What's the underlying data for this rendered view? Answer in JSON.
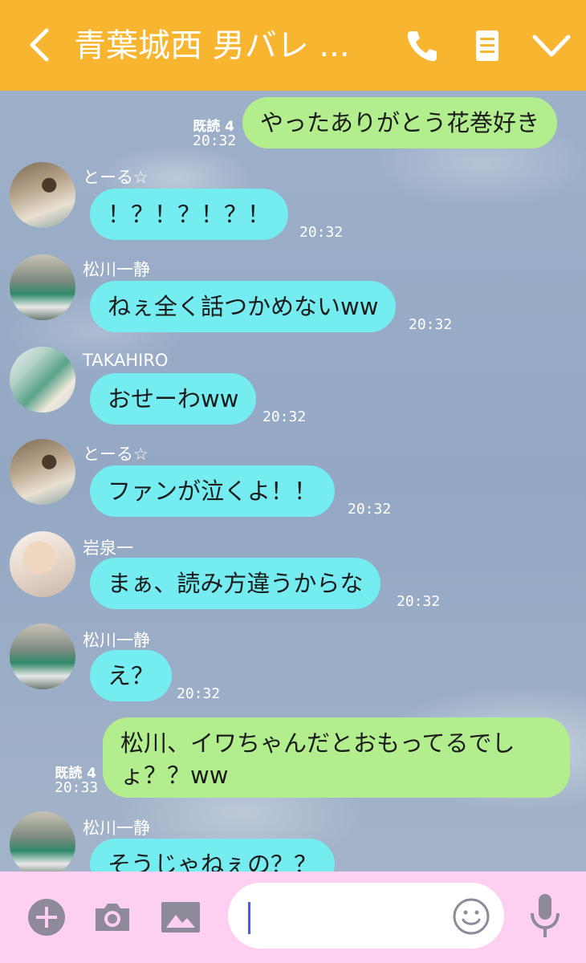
{
  "header": {
    "title": "青葉城西 男バレ ...",
    "back_icon": "back-chevron-icon",
    "call_icon": "phone-icon",
    "notes_icon": "notes-icon",
    "menu_icon": "chevron-down-icon",
    "background": "#f7b530"
  },
  "messages": [
    {
      "side": "out",
      "text": "やったありがとう花巻好き",
      "read": "既読 4",
      "time": "20:32"
    },
    {
      "side": "in",
      "sender": "とーる☆",
      "text": "！？！？！？！",
      "time": "20:32"
    },
    {
      "side": "in",
      "sender": "松川一静",
      "text": "ねぇ全く話つかめないww",
      "time": "20:32"
    },
    {
      "side": "in",
      "sender": "TAKAHIRO",
      "text": "おせーわww",
      "time": "20:32"
    },
    {
      "side": "in",
      "sender": "とーる☆",
      "text": "ファンが泣くよ！！",
      "time": "20:32"
    },
    {
      "side": "in",
      "sender": "岩泉一",
      "text": "まぁ、読み方違うからな",
      "time": "20:32"
    },
    {
      "side": "in",
      "sender": "松川一静",
      "text": "え？",
      "time": "20:32"
    },
    {
      "side": "out",
      "text": "松川、イワちゃんだとおもってるでしょ？？ww",
      "read": "既読 4",
      "time": "20:33"
    },
    {
      "side": "in",
      "sender": "松川一静",
      "text": "そうじゃねぇの？？"
    }
  ],
  "bottom": {
    "add_icon": "plus-circle-icon",
    "camera_icon": "camera-icon",
    "image_icon": "image-icon",
    "emoji_icon": "smiley-icon",
    "mic_icon": "microphone-icon",
    "input_value": "",
    "background": "#fdd0f1"
  },
  "colors": {
    "incoming_bubble": "#74ecf0",
    "outgoing_bubble": "#b3ee8e",
    "accent": "#f7b530"
  }
}
